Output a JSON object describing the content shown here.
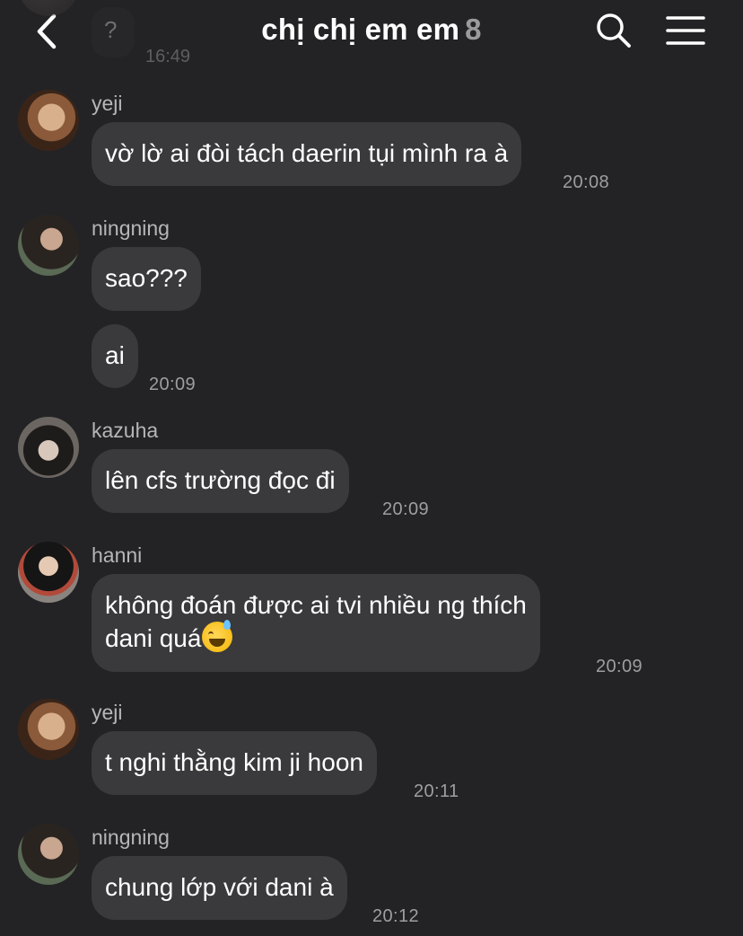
{
  "header": {
    "title": "chị chị em em",
    "member_count": "8",
    "back_icon": "chevron-left-icon",
    "search_icon": "search-icon",
    "menu_icon": "hamburger-menu-icon"
  },
  "previous_message": {
    "text": "?",
    "time": "16:49"
  },
  "messages": [
    {
      "sender": "yeji",
      "lines": [
        "vờ lờ ai đòi tách daerin tụi mình ra à"
      ],
      "time": "20:08"
    },
    {
      "sender": "ningning",
      "lines": [
        "sao???"
      ],
      "time": ""
    },
    {
      "sender": "",
      "lines": [
        "ai"
      ],
      "time": "20:09"
    },
    {
      "sender": "kazuha",
      "lines": [
        "lên cfs trường đọc đi"
      ],
      "time": "20:09"
    },
    {
      "sender": "hanni",
      "lines": [
        "không đoán được ai tvi nhiều ng thích",
        "dani quá"
      ],
      "emoji": "grinning-face-with-sweat-emoji",
      "time": "20:09"
    },
    {
      "sender": "yeji",
      "lines": [
        "t nghi thằng kim ji hoon"
      ],
      "time": "20:11"
    },
    {
      "sender": "ningning",
      "lines": [
        "chung lớp với dani à"
      ],
      "time": "20:12"
    }
  ],
  "colors": {
    "background": "#232325",
    "bubble": "#3a3a3c",
    "sender_text": "#b5b5ba",
    "time_text": "#9e9ea3",
    "member_count": "#9a9a9e"
  }
}
